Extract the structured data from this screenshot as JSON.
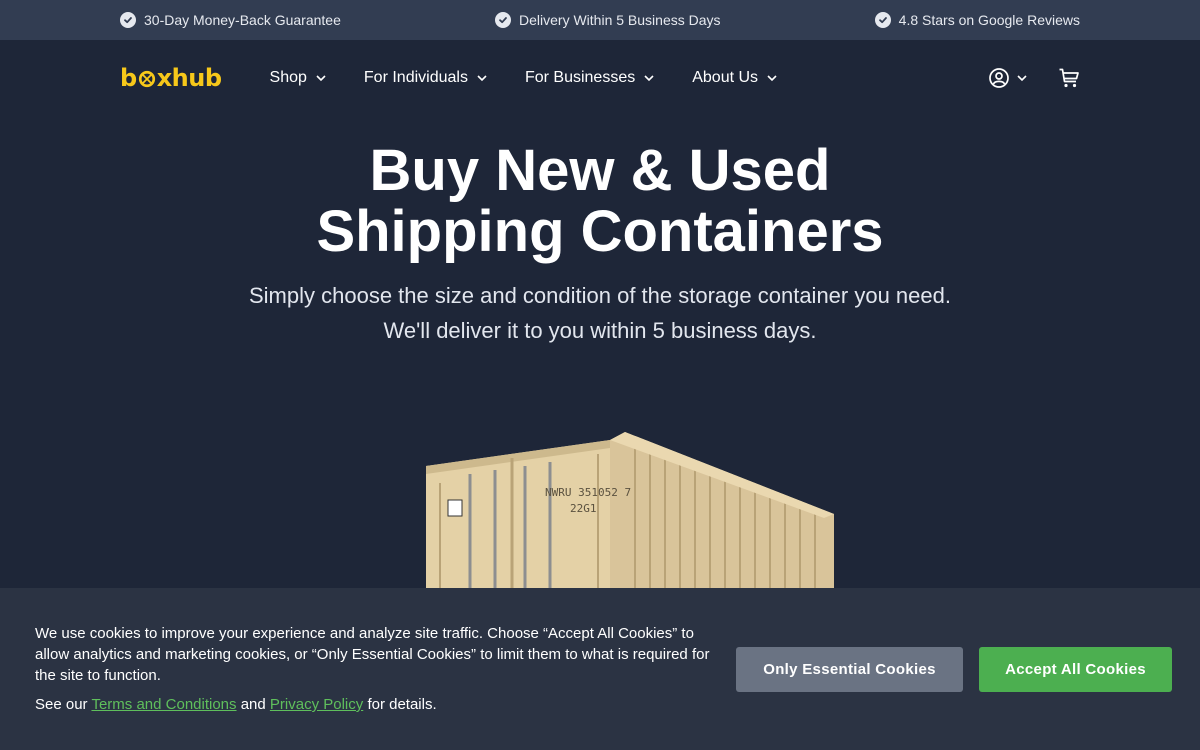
{
  "topbar": {
    "perks": [
      "30-Day Money-Back Guarantee",
      "Delivery Within 5 Business Days",
      "4.8 Stars on Google Reviews"
    ]
  },
  "header": {
    "logo": {
      "prefix": "b",
      "suffix": "xhub",
      "color": "#f7c81a"
    },
    "nav": [
      "Shop",
      "For Individuals",
      "For Businesses",
      "About Us"
    ],
    "icons": [
      "account-icon",
      "cart-icon"
    ]
  },
  "hero": {
    "title_line1": "Buy New & Used",
    "title_line2": "Shipping Containers",
    "subtitle_line1": "Simply choose the size and condition of the storage container you need.",
    "subtitle_line2": "We'll deliver it to you within 5 business days.",
    "container_markings": {
      "id": "NWRU 351052 7",
      "type": "22G1"
    }
  },
  "cookie_banner": {
    "text": "We use cookies to improve your experience and analyze site traffic. Choose “Accept All Cookies” to allow analytics and marketing cookies, or “Only Essential Cookies” to limit them to what is required for the site to function.",
    "see_our": "See our",
    "terms_link": "Terms and Conditions",
    "and": "and",
    "privacy_link": "Privacy Policy",
    "for_details": "for details.",
    "essential_button": "Only Essential Cookies",
    "accept_button": "Accept All Cookies"
  },
  "colors": {
    "background": "#1e2638",
    "topbar": "#323d52",
    "brand_yellow": "#f7c81a",
    "accept_green": "#4caf50",
    "link_green": "#5fbf5c"
  }
}
